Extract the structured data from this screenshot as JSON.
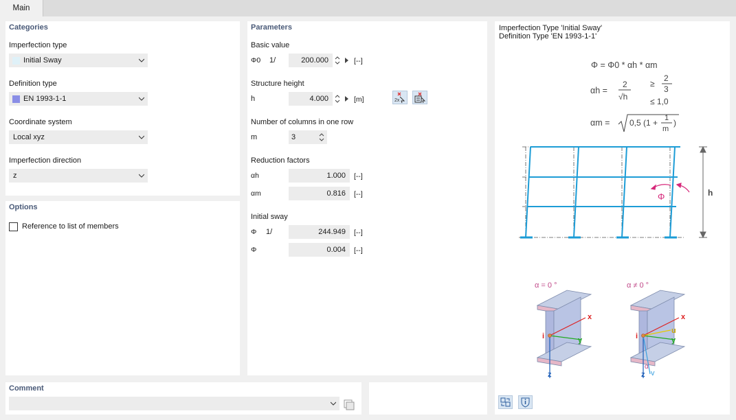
{
  "tabs": [
    {
      "label": "Main"
    }
  ],
  "categories": {
    "title": "Categories",
    "imperfection_type": {
      "label": "Imperfection type",
      "value": "Initial Sway",
      "swatch": "#dff1f8"
    },
    "definition_type": {
      "label": "Definition type",
      "value": "EN 1993-1-1",
      "swatch": "#8a8ee6"
    },
    "coordinate_system": {
      "label": "Coordinate system",
      "value": "Local xyz"
    },
    "imperfection_direction": {
      "label": "Imperfection direction",
      "value": "z"
    }
  },
  "options": {
    "title": "Options",
    "reference_to_list": {
      "label": "Reference to list of members",
      "checked": false
    }
  },
  "parameters": {
    "title": "Parameters",
    "basic_value": {
      "label": "Basic value",
      "symbol": "Φ0",
      "prefix": "1/",
      "value": "200.000",
      "unit": "[--]"
    },
    "structure_height": {
      "label": "Structure height",
      "symbol": "h",
      "value": "4.000",
      "unit": "[m]"
    },
    "columns": {
      "label": "Number of columns in one row",
      "symbol": "m",
      "value": "3"
    },
    "reduction": {
      "label": "Reduction factors",
      "alpha_h": {
        "symbol": "αh",
        "value": "1.000",
        "unit": "[--]"
      },
      "alpha_m": {
        "symbol": "αm",
        "value": "0.816",
        "unit": "[--]"
      }
    },
    "initial_sway": {
      "label": "Initial sway",
      "phi_inv": {
        "symbol": "Φ",
        "prefix": "1/",
        "value": "244.949",
        "unit": "[--]"
      },
      "phi": {
        "symbol": "Φ",
        "value": "0.004",
        "unit": "[--]"
      }
    }
  },
  "comment": {
    "title": "Comment",
    "value": ""
  },
  "info": {
    "line1": "Imperfection Type 'Initial Sway'",
    "line2": "Definition Type 'EN 1993-1-1'",
    "formula_phi": "Φ = Φ0 * αh * αm",
    "formula_ah_lhs": "αh =",
    "formula_ah_num": "2",
    "formula_ah_den": "√h",
    "formula_ah_ge": "≥",
    "formula_ah_ge_num": "2",
    "formula_ah_ge_den": "3",
    "formula_ah_le": "≤ 1,0",
    "formula_am_lhs": "αm =",
    "formula_am_body": "0,5 (1 +",
    "formula_am_num": "1",
    "formula_am_den": "m",
    "formula_am_close": ")",
    "diagram_h": "h",
    "diagram_phi": "Φ",
    "beam1_title": "α = 0 °",
    "beam2_title": "α ≠ 0 °",
    "axis_x": "x",
    "axis_y": "y",
    "axis_z": "z",
    "axis_u": "u",
    "axis_v": "v",
    "axis_alpha": "α",
    "point_i": "i"
  }
}
